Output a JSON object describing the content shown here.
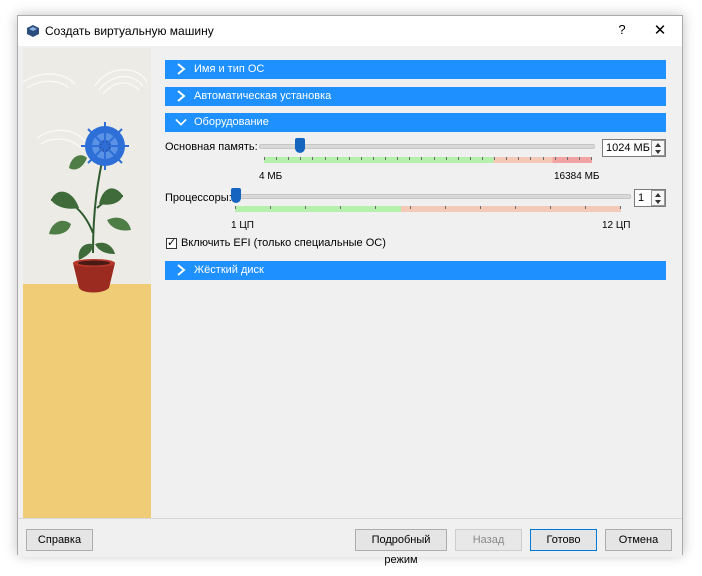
{
  "window": {
    "title": "Создать виртуальную машину",
    "help_label": "?",
    "close_label": "✕"
  },
  "sections": {
    "name_os": "Имя и тип ОС",
    "unattended": "Автоматическая установка",
    "hardware": "Оборудование",
    "hard_disk": "Жёсткий диск"
  },
  "hardware": {
    "memory": {
      "label": "Основная память:",
      "value": "1024 МБ",
      "min_label": "4 МБ",
      "max_label": "16384 МБ",
      "value_mb": 1024,
      "min_mb": 4,
      "max_mb": 16384
    },
    "cpu": {
      "label": "Процессоры:",
      "value": "1",
      "min_label": "1 ЦП",
      "max_label": "12 ЦП",
      "value_num": 1,
      "min_num": 1,
      "max_num": 12
    },
    "efi": {
      "label": "Включить EFI (только специальные ОС)",
      "checked": true,
      "check_glyph": "✓"
    }
  },
  "footer": {
    "help": "Справка",
    "expert": "Подробный режим",
    "back": "Назад",
    "finish": "Готово",
    "cancel": "Отмена"
  },
  "colors": {
    "accent": "#1e90ff",
    "handle": "#1565c0",
    "scale_ok": "#b6f0ad",
    "scale_warn": "#f5c9b8",
    "scale_bad": "#f2a3a3"
  },
  "icons": {
    "app": "virtualbox-icon",
    "section_collapsed": "chevron-right-icon",
    "section_expanded": "chevron-down-icon"
  }
}
